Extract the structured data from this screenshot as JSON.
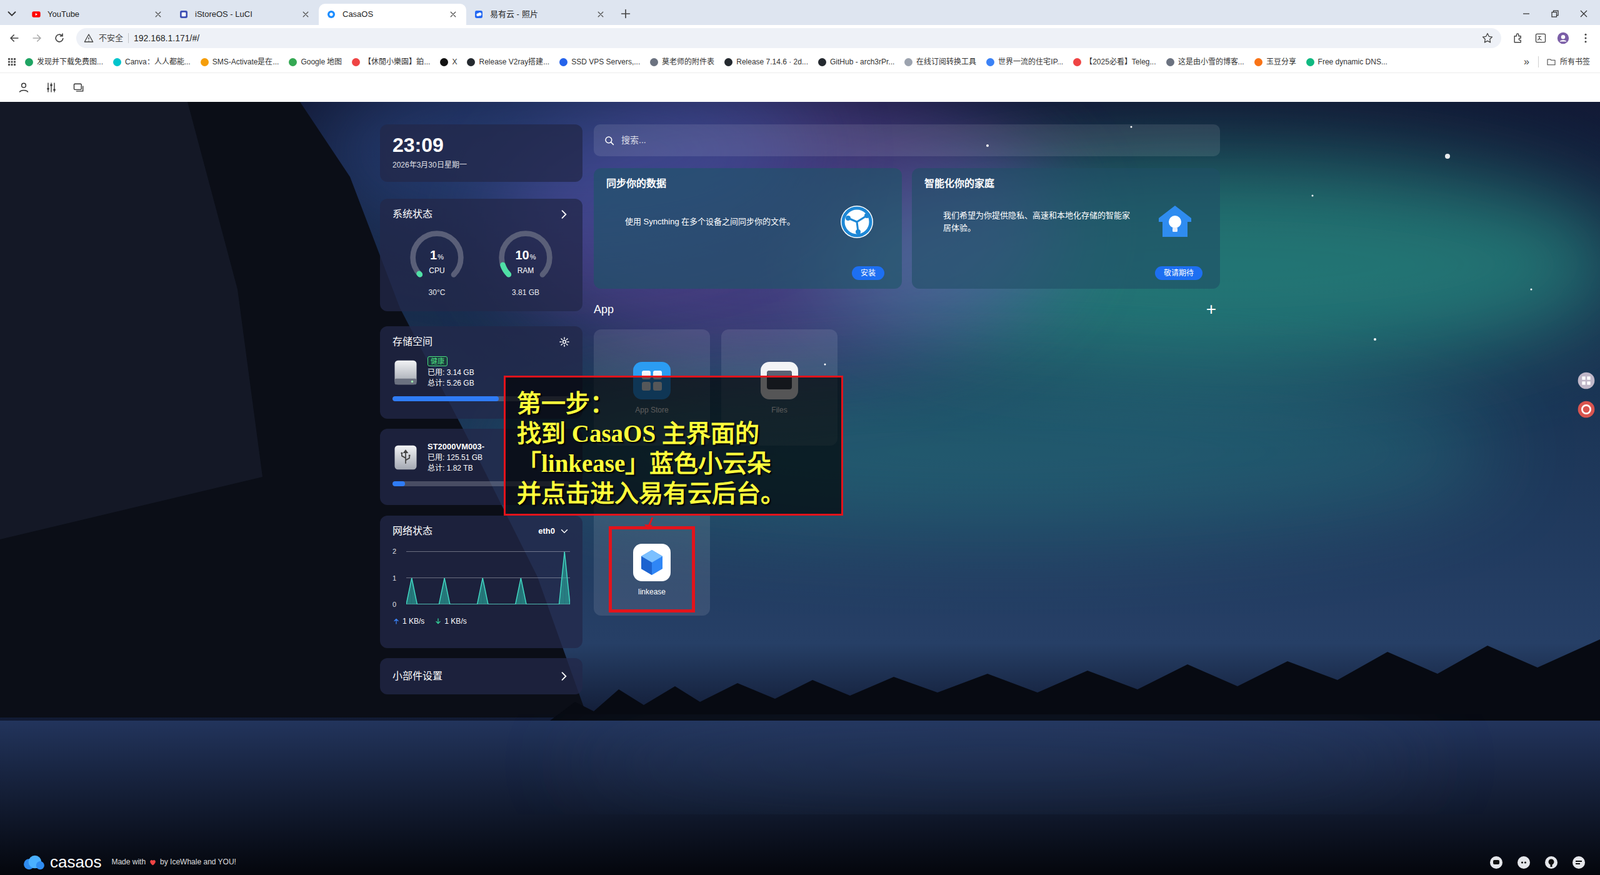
{
  "browser": {
    "tabs": [
      {
        "label": "YouTube",
        "selected": false
      },
      {
        "label": "iStoreOS - LuCI",
        "selected": false
      },
      {
        "label": "CasaOS",
        "selected": true
      },
      {
        "label": "易有云 - 照片",
        "selected": false
      }
    ],
    "security_label": "不安全",
    "url": "192.168.1.171/#/",
    "bookmarks": [
      "发现并下载免费图...",
      "Canva：人人都能...",
      "SMS-Activate是在...",
      "Google 地图",
      "【休閒小樂園】鉑...",
      "X",
      "Release V2ray搭建...",
      "SSD VPS Servers,...",
      "莫老师的附件表",
      "Release 7.14.6 · 2d...",
      "GitHub - arch3rPr...",
      "在线订阅转换工具",
      "世界一流的住宅IP...",
      "【2025必看】Teleg...",
      "这是由小雪的博客...",
      "玉豆分享",
      "Free dynamic DNS..."
    ],
    "more": "»",
    "all_bookmarks": "所有书签"
  },
  "casaos": {
    "clock": {
      "time": "23:09",
      "date": "2026年3月30日星期一"
    },
    "system_status": {
      "title": "系统状态",
      "gauges": [
        {
          "label": "CPU",
          "value": "1",
          "unit": "%",
          "detail": "30°C",
          "level": 0.01
        },
        {
          "label": "RAM",
          "value": "10",
          "unit": "%",
          "detail": "3.81 GB",
          "level": 0.1
        }
      ]
    },
    "storage": {
      "title": "存储空间",
      "disks": [
        {
          "kind": "system",
          "badge": "健康",
          "used": "已用: 3.14 GB",
          "total": "总计: 5.26 GB",
          "level": 0.6
        },
        {
          "kind": "usb",
          "name": "ST2000VM003-",
          "used": "已用: 125.51 GB",
          "total": "总计: 1.82 TB",
          "level": 0.07
        }
      ]
    },
    "network": {
      "title": "网络状态",
      "interface": "eth0",
      "ticks": [
        "2",
        "1",
        "0"
      ],
      "traffic": [
        0,
        1,
        0,
        0,
        0,
        0,
        0,
        1,
        0,
        0,
        0,
        0,
        0,
        0,
        1,
        0,
        0,
        0,
        0,
        0,
        0,
        1,
        0,
        0,
        0,
        0,
        0,
        0,
        0,
        2,
        0
      ],
      "upload": "1 KB/s",
      "download": "1 KB/s"
    },
    "widget_settings": "小部件设置",
    "search": {
      "placeholder": "搜索..."
    },
    "feature_cards": [
      {
        "title": "同步你的数据",
        "text": "使用 Syncthing 在多个设备之间同步你的文件。",
        "button": "安装"
      },
      {
        "title": "智能化你的家庭",
        "text": "我们希望为你提供隐私、高速和本地化存储的智能家居体验。",
        "button": "敬请期待"
      }
    ],
    "apps": {
      "title": "App",
      "add": "+",
      "items": [
        {
          "name": "App Store",
          "highlighted": false
        },
        {
          "name": "Files",
          "highlighted": false
        },
        {
          "name": "linkease",
          "highlighted": true
        }
      ]
    }
  },
  "annotation": {
    "lines": [
      "第一步：",
      "找到 CasaOS 主界面的",
      "「linkease」蓝色小云朵",
      "并点击进入易有云后台。"
    ]
  },
  "footer": {
    "logo": "casaos",
    "made_with": "Made with",
    "credit": "by IceWhale and YOU!"
  }
}
